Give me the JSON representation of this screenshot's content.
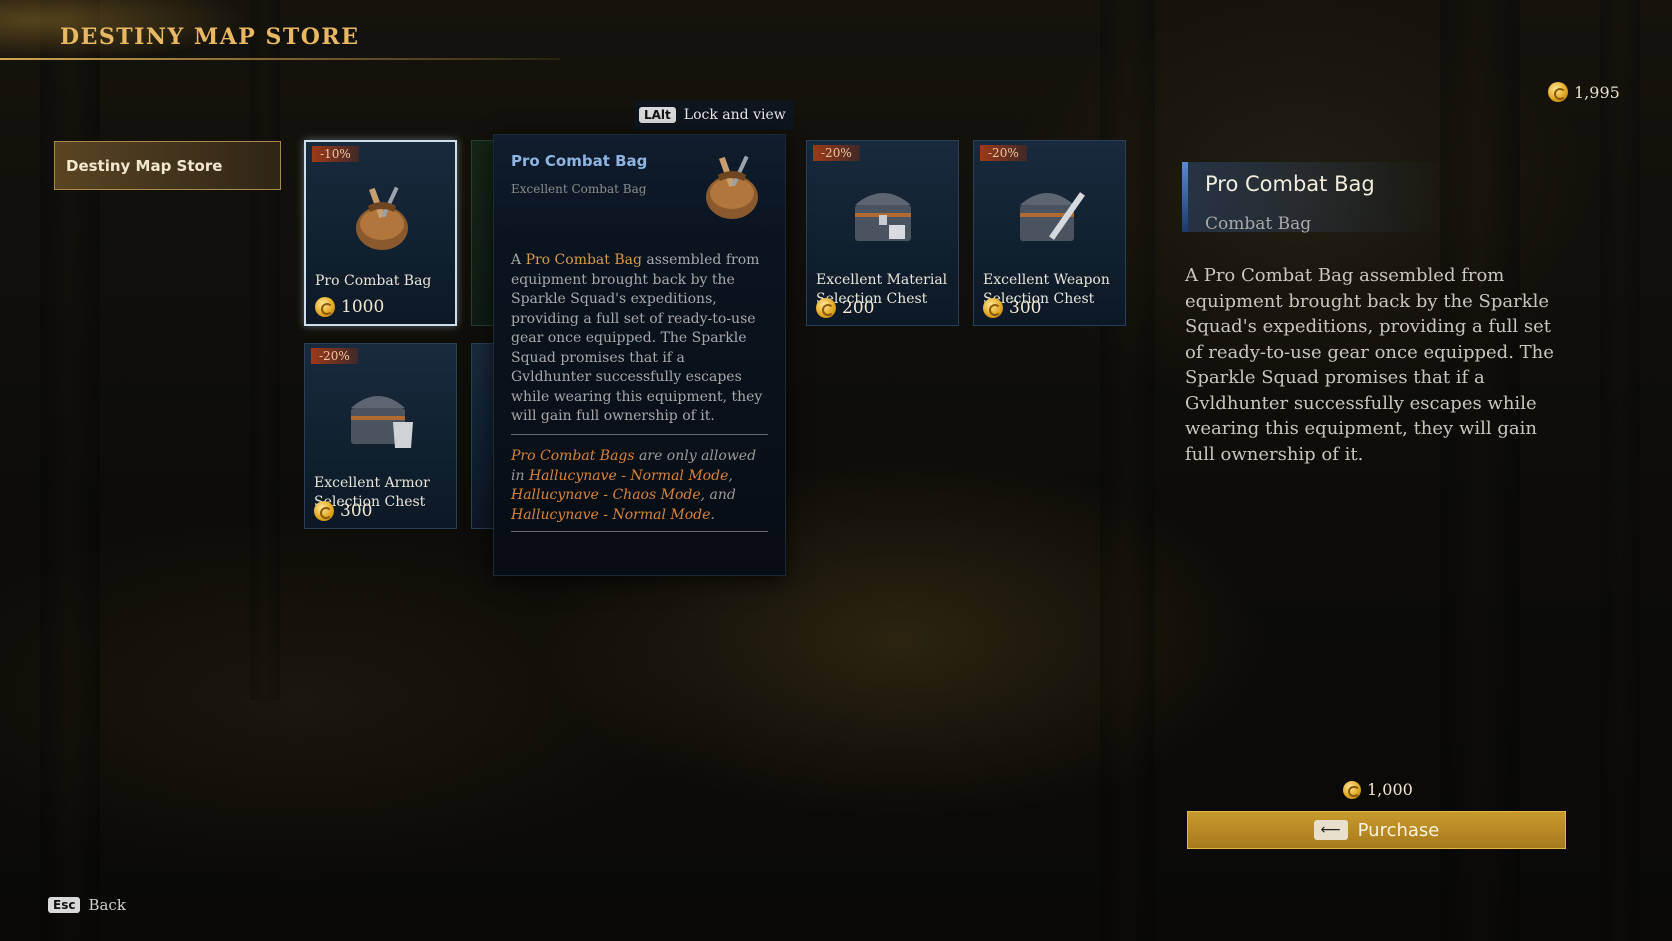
{
  "header": {
    "title": "DESTINY MAP STORE"
  },
  "currency": {
    "amount": "1,995",
    "icon": "coin-icon",
    "color": "#e3a923"
  },
  "sidebar": {
    "tabs": [
      {
        "label": "Destiny Map Store"
      }
    ]
  },
  "cards": [
    {
      "discount": "-10%",
      "name": "Pro Combat Bag",
      "price": "1000",
      "icon": "combat-bag-icon",
      "selected": true
    },
    {
      "discount": "-20%",
      "name": "Excellent Material Selection Chest",
      "price": "200",
      "icon": "chest-icon"
    },
    {
      "discount": "-20%",
      "name": "Excellent Weapon Selection Chest",
      "price": "300",
      "icon": "weapon-chest-icon"
    },
    {
      "discount": "-20%",
      "name": "Excellent Armor Selection Chest",
      "price": "300",
      "icon": "armor-chest-icon"
    }
  ],
  "tooltip": {
    "hint_key": "LAlt",
    "hint_label": "Lock and view",
    "title": "Pro Combat Bag",
    "subtitle": "Excellent Combat Bag",
    "desc_pre": "A ",
    "desc_highlight": "Pro Combat Bag",
    "desc_post": " assembled from equipment brought back by the Sparkle Squad's expeditions, providing a full set of ready-to-use gear once equipped. The Sparkle Squad promises that if a Gvldhunter successfully escapes while wearing this equipment, they will gain full ownership of it.",
    "note_item": "Pro Combat Bags",
    "note_mid": " are only allowed in ",
    "note_mode1": "Hallucynave - Normal Mode",
    "note_sep1": ", ",
    "note_mode2": "Hallucynave - Chaos Mode",
    "note_sep2": ", and ",
    "note_mode3": "Hallucynave - Normal Mode",
    "note_end": "."
  },
  "detail": {
    "title": "Pro Combat Bag",
    "subtitle": "Combat Bag",
    "description": "A Pro Combat Bag assembled from equipment brought back by the Sparkle Squad's expeditions, providing a full set of ready-to-use gear once equipped. The Sparkle Squad promises that if a Gvldhunter successfully escapes while wearing this equipment, they will gain full ownership of it.",
    "price": "1,000",
    "purchase_label": "Purchase",
    "purchase_key": "⟵"
  },
  "footer": {
    "back_key": "Esc",
    "back_label": "Back"
  },
  "colors": {
    "accent_gold": "#e8b863",
    "selected_border": "#cfdcea",
    "highlight": "#d99a4e"
  }
}
